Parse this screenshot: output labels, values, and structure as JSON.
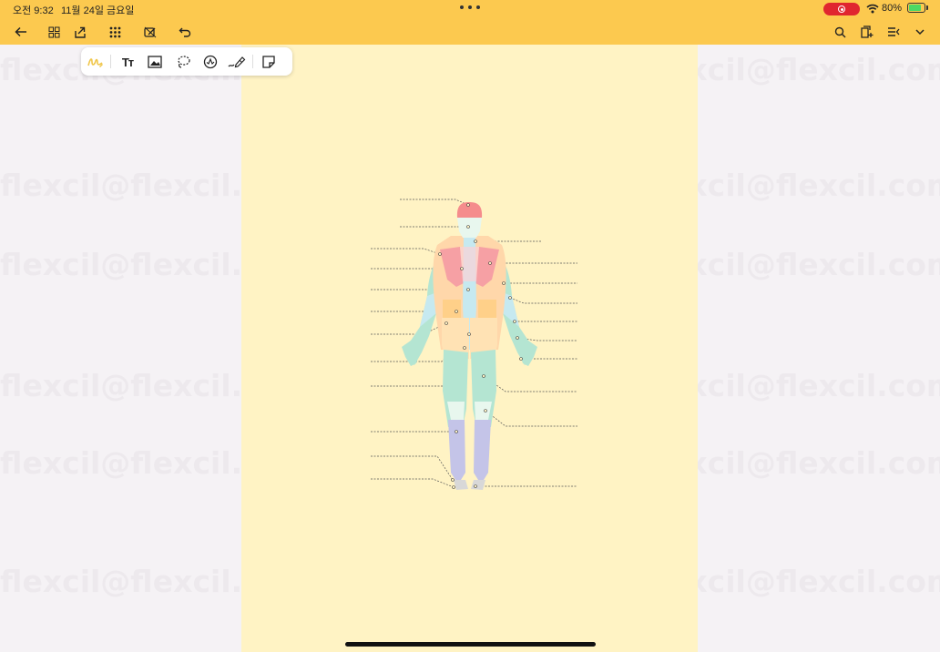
{
  "status_bar": {
    "time": "오전 9:32",
    "date": "11월 24일 금요일",
    "battery_percent": "80%",
    "battery_level": 0.8,
    "recording_color": "#e0262f"
  },
  "toolbar": {
    "left_icons": [
      "back-arrow-icon",
      "grid-view-icon",
      "export-icon",
      "apps-icon",
      "edit-off-icon",
      "undo-icon"
    ],
    "right_icons": [
      "search-icon",
      "page-add-icon",
      "list-menu-icon",
      "chevron-down-icon"
    ],
    "background_color": "#fcc94f"
  },
  "tool_panel": {
    "tools": [
      "pen-icon",
      "text-icon",
      "image-icon",
      "lasso-icon",
      "sticker-icon",
      "highlighter-icon",
      "sticky-note-icon"
    ],
    "text_tool_label": "Tт"
  },
  "watermark": {
    "text": "flexcil@flexcil.com flexcil@flexcil.com flexcil@flexcil.com flexc..."
  },
  "page": {
    "background_color": "#fff3c4"
  }
}
